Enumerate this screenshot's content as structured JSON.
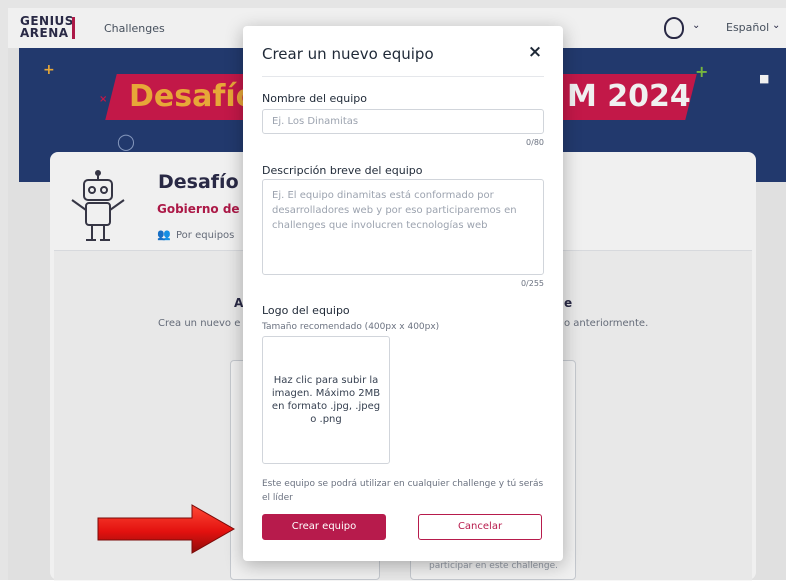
{
  "navbar": {
    "logo_line1": "GENIUS",
    "logo_line2": "ARENA",
    "nav_link": "Challenges",
    "language": "Español"
  },
  "banner": {
    "title_left": "Desafío",
    "title_right": "M 2024"
  },
  "challenge": {
    "title": "Desafío",
    "organization": "Gobierno de",
    "mode": "Por equipos"
  },
  "background_columns": {
    "left_heading": "A",
    "left_desc": "Crea un nuevo e",
    "right_heading": "e",
    "right_desc": "o anteriormente.",
    "right_option_text": "participar en este challenge."
  },
  "modal": {
    "title": "Crear un nuevo equipo",
    "close_symbol": "×",
    "team_name": {
      "label": "Nombre del equipo",
      "placeholder": "Ej. Los Dinamitas",
      "value": "",
      "counter": "0/80"
    },
    "description": {
      "label": "Descripción breve del equipo",
      "placeholder": "Ej. El equipo dinamitas está conformado por desarrolladores web y por eso participaremos en challenges que involucren tecnologías web",
      "value": "",
      "counter": "0/255"
    },
    "logo": {
      "label": "Logo del equipo",
      "hint": "Tamaño recomendado (400px x 400px)",
      "upload_text": "Haz clic para subir la imagen. Máximo 2MB en formato .jpg, .jpeg o .png"
    },
    "info_text": "Este equipo se podrá utilizar en cualquier challenge y tú serás el líder",
    "primary_button": "Crear equipo",
    "secondary_button": "Cancelar"
  },
  "colors": {
    "brand": "#b71b4c",
    "banner_bg": "#253d74",
    "banner_accent": "#f6b23c",
    "arrow": "#e3110f"
  }
}
